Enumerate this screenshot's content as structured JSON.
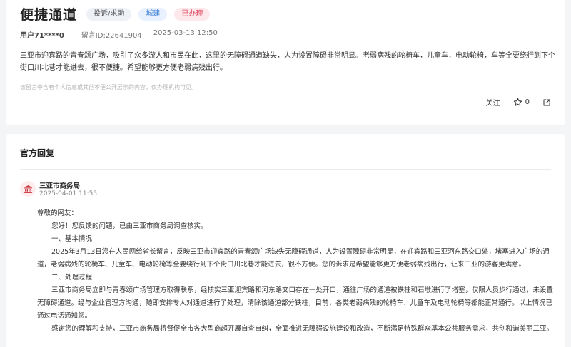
{
  "header": {
    "title": "便捷通道",
    "tags": {
      "category": "投诉/求助",
      "department": "城建",
      "status": "已办理"
    }
  },
  "meta": {
    "user": "用户71****0",
    "message_id": "留言ID:22641904",
    "datetime": "2025-03-13 12:50"
  },
  "message": {
    "content": "三亚市迎宾路的青春颂广场，吸引了众多游人和市民在此，这里的无障碍通道缺失，人为设置障碍非常明显。老弱病残的轮椅车，儿童车，电动轮椅，车等全要绕行到下个街口川北巷才能进去，很不便捷。希望能够更方便老弱病残出行。",
    "privacy_notice": "该留言中含有个人信息或其他不便公开展示的内容，仅办理机构可见。"
  },
  "actions": {
    "follow_label": "关注",
    "star_count": "0"
  },
  "official_reply": {
    "section_title": "官方回复",
    "org_name": "三亚市商务局",
    "date": "2025-04-01 11:55",
    "greeting": "尊敬的网友：",
    "paragraphs": [
      "您好！您反馈的问题，已由三亚市商务局调查核实。",
      "一、基本情况",
      "2025年3月13日您在人民网给省长留言，反映三亚市迎宾路的青春颂广场缺失无障碍通道，人为设置障碍非常明显，在迎宾路和三亚河东路交口处，堵塞进入广场的通道，老弱病残的轮椅车、儿童车、电动轮椅等全要绕行到下个街口川北巷才能进去，很不方便。您的诉求是希望能够更方便老弱病残出行，让来三亚的游客更满意。",
      "二、处理过程",
      "三亚市商务局立即与青春颂广场管理方取得联系，经核实三亚迎宾路和河东路交口存在一处开口，通往广场的通道被铁柱和石墩进行了堵塞，仅限人员步行通过，未设置无障碍通道。经与企业管理方沟通，随即安排专人对通道进行了处理，清除该通道部分铁柱，目前，各类老弱病残的轮椅车、儿童车及电动轮椅等都能正常通行。以上情况已通过电话通知您。",
      "感谢您的理解和支持，三亚市商务局将督促全市各大型商超开展自查自纠，全面推进无障碍设施建设和改造，不断满足特殊群众基本公共服务需求，共创和谐美丽三亚。"
    ]
  },
  "colors": {
    "page_bg": "#f4f5f7",
    "status_red": "#e0465e",
    "department_blue": "#3b7fd9",
    "org_icon": "#c9343f"
  },
  "icons": [
    "star-icon",
    "share-icon",
    "government-building-icon"
  ]
}
